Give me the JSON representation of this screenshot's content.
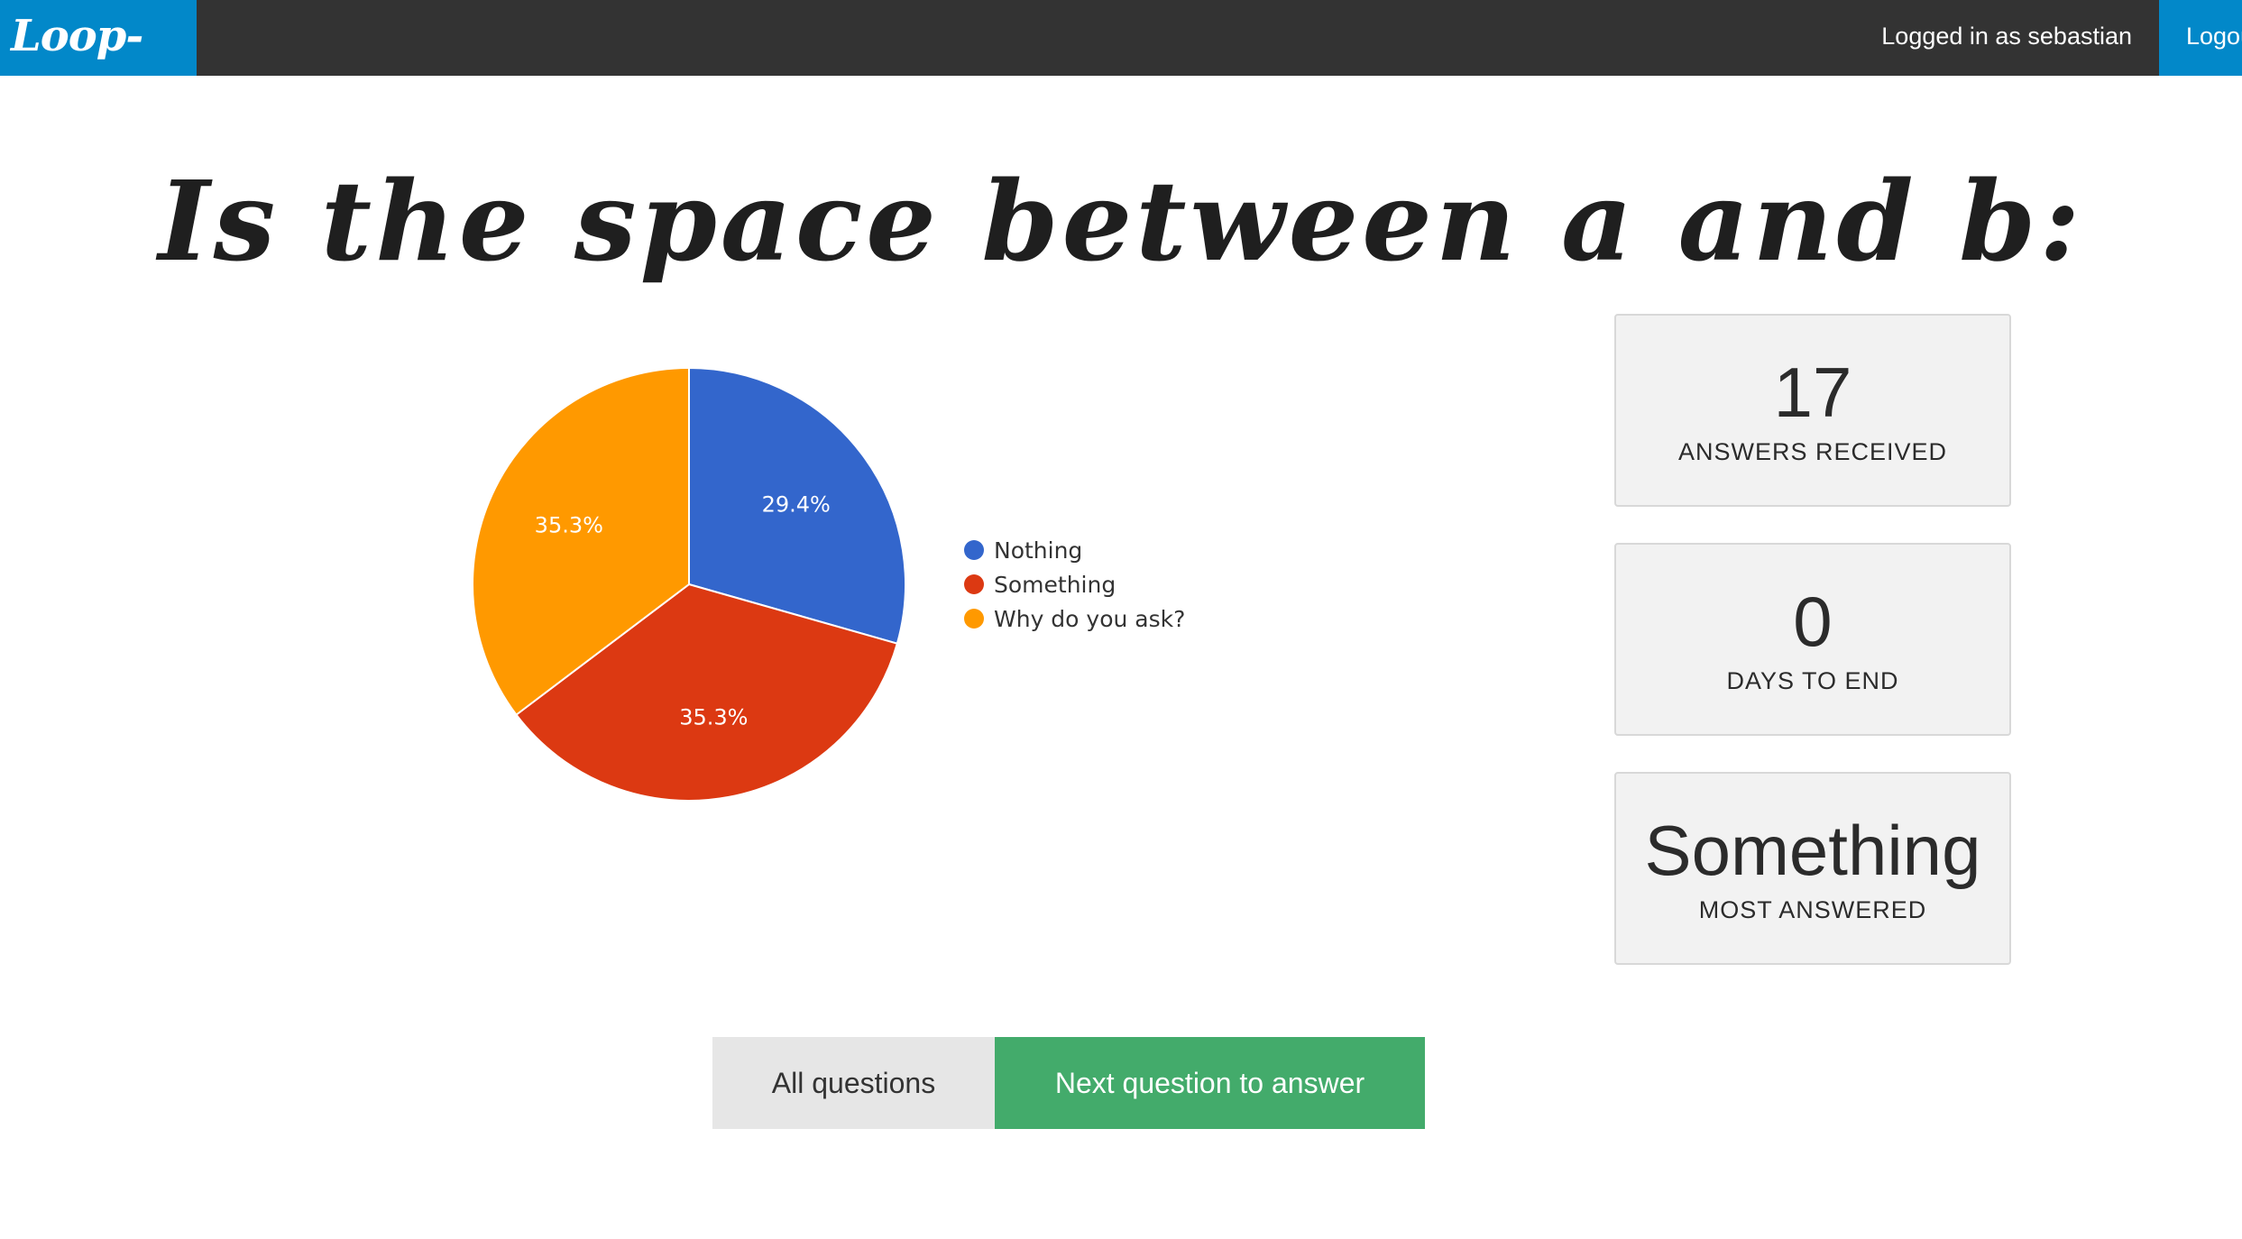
{
  "navbar": {
    "brand": "Loop-oll",
    "user_text": "Logged in as sebastian",
    "logout_label": "Logout",
    "brand_color": "#0288c9"
  },
  "question": {
    "title": "Is the space between a and b:"
  },
  "chart_data": {
    "type": "pie",
    "title": "",
    "categories": [
      "Nothing",
      "Something",
      "Why do you ask?"
    ],
    "values": [
      5,
      6,
      6
    ],
    "percent_labels": [
      "29.4%",
      "35.3%",
      "35.3%"
    ],
    "colors": [
      "#3366cc",
      "#dc3912",
      "#ff9900"
    ],
    "legend": "right"
  },
  "stats": [
    {
      "value": "17",
      "label": "ANSWERS RECEIVED"
    },
    {
      "value": "0",
      "label": "DAYS TO END"
    },
    {
      "value": "Something",
      "label": "MOST ANSWERED"
    }
  ],
  "actions": {
    "all_questions_label": "All questions",
    "next_question_label": "Next question to answer"
  }
}
